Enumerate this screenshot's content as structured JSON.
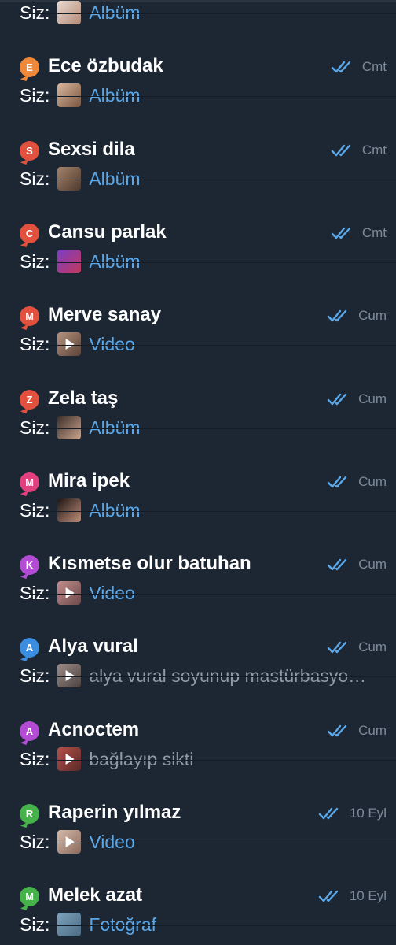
{
  "you_label": "Siz:",
  "chats": [
    {
      "initial": "",
      "badge_color": "",
      "name": "",
      "time": "",
      "you_label": "Siz:",
      "preview": "Albüm",
      "preview_kind": "media",
      "thumb_kind": "photo",
      "thumb_colors": [
        "#e9d9cf",
        "#b48a77"
      ]
    },
    {
      "initial": "E",
      "badge_color": "#f0883a",
      "name": "Ece özbudak",
      "time": "Cmt",
      "you_label": "Siz:",
      "preview": "Albüm",
      "preview_kind": "media",
      "thumb_kind": "photo",
      "thumb_colors": [
        "#d9b79c",
        "#7a5540"
      ]
    },
    {
      "initial": "S",
      "badge_color": "#e2513d",
      "name": "Sexsi dila",
      "time": "Cmt",
      "you_label": "Siz:",
      "preview": "Albüm",
      "preview_kind": "media",
      "thumb_kind": "photo",
      "thumb_colors": [
        "#a5826a",
        "#4d3a2e"
      ]
    },
    {
      "initial": "C",
      "badge_color": "#e2513d",
      "name": "Cansu parlak",
      "time": "Cmt",
      "you_label": "Siz:",
      "preview": "Albüm",
      "preview_kind": "media",
      "thumb_kind": "photo",
      "thumb_colors": [
        "#7b3cc6",
        "#c23a5a"
      ]
    },
    {
      "initial": "M",
      "badge_color": "#e2513d",
      "name": "Merve sanay",
      "time": "Cum",
      "you_label": "Siz:",
      "preview": "Video",
      "preview_kind": "media",
      "thumb_kind": "video",
      "thumb_colors": [
        "#b79380",
        "#5a4235"
      ]
    },
    {
      "initial": "Z",
      "badge_color": "#e2513d",
      "name": "Zela taş",
      "time": "Cum",
      "you_label": "Siz:",
      "preview": "Albüm",
      "preview_kind": "media",
      "thumb_kind": "photo",
      "thumb_colors": [
        "#3c2d28",
        "#caa58f"
      ]
    },
    {
      "initial": "M",
      "badge_color": "#e2417f",
      "name": "Mira ipek",
      "time": "Cum",
      "you_label": "Siz:",
      "preview": "Albüm",
      "preview_kind": "media",
      "thumb_kind": "photo",
      "thumb_colors": [
        "#1b1414",
        "#c08e79"
      ]
    },
    {
      "initial": "K",
      "badge_color": "#b34bd4",
      "name": "Kısmetse olur batuhan",
      "time": "Cum",
      "you_label": "Siz:",
      "preview": "Video",
      "preview_kind": "media",
      "thumb_kind": "video",
      "thumb_colors": [
        "#c48c8c",
        "#6b4a4a"
      ]
    },
    {
      "initial": "A",
      "badge_color": "#3b8de0",
      "name": "Alya vural",
      "time": "Cum",
      "you_label": "Siz:",
      "preview": "alya vural soyunup mastürbasyo…",
      "preview_kind": "text",
      "thumb_kind": "video",
      "thumb_colors": [
        "#9c8c86",
        "#4c4240"
      ]
    },
    {
      "initial": "A",
      "badge_color": "#b34bd4",
      "name": "Acnoctem",
      "time": "Cum",
      "you_label": "Siz:",
      "preview": "bağlayıp sikti",
      "preview_kind": "text",
      "thumb_kind": "video",
      "thumb_colors": [
        "#b4504a",
        "#5a2a26"
      ]
    },
    {
      "initial": "R",
      "badge_color": "#46b34a",
      "name": "Raperin yılmaz",
      "time": "10 Eyl",
      "you_label": "Siz:",
      "preview": "Video",
      "preview_kind": "media",
      "thumb_kind": "video",
      "thumb_colors": [
        "#d6b9a8",
        "#8a6a5c"
      ]
    },
    {
      "initial": "M",
      "badge_color": "#46b34a",
      "name": "Melek azat",
      "time": "10 Eyl",
      "you_label": "Siz:",
      "preview": "Fotoğraf",
      "preview_kind": "media",
      "thumb_kind": "photo",
      "thumb_colors": [
        "#7ea3bd",
        "#4b6b82"
      ]
    }
  ],
  "colors": {
    "background": "#1d2733",
    "accent": "#5aa8ea",
    "ticks": "#5aa8ea",
    "date": "#7c8a99",
    "name": "#ffffff",
    "preview_text": "#8e9aa6"
  }
}
